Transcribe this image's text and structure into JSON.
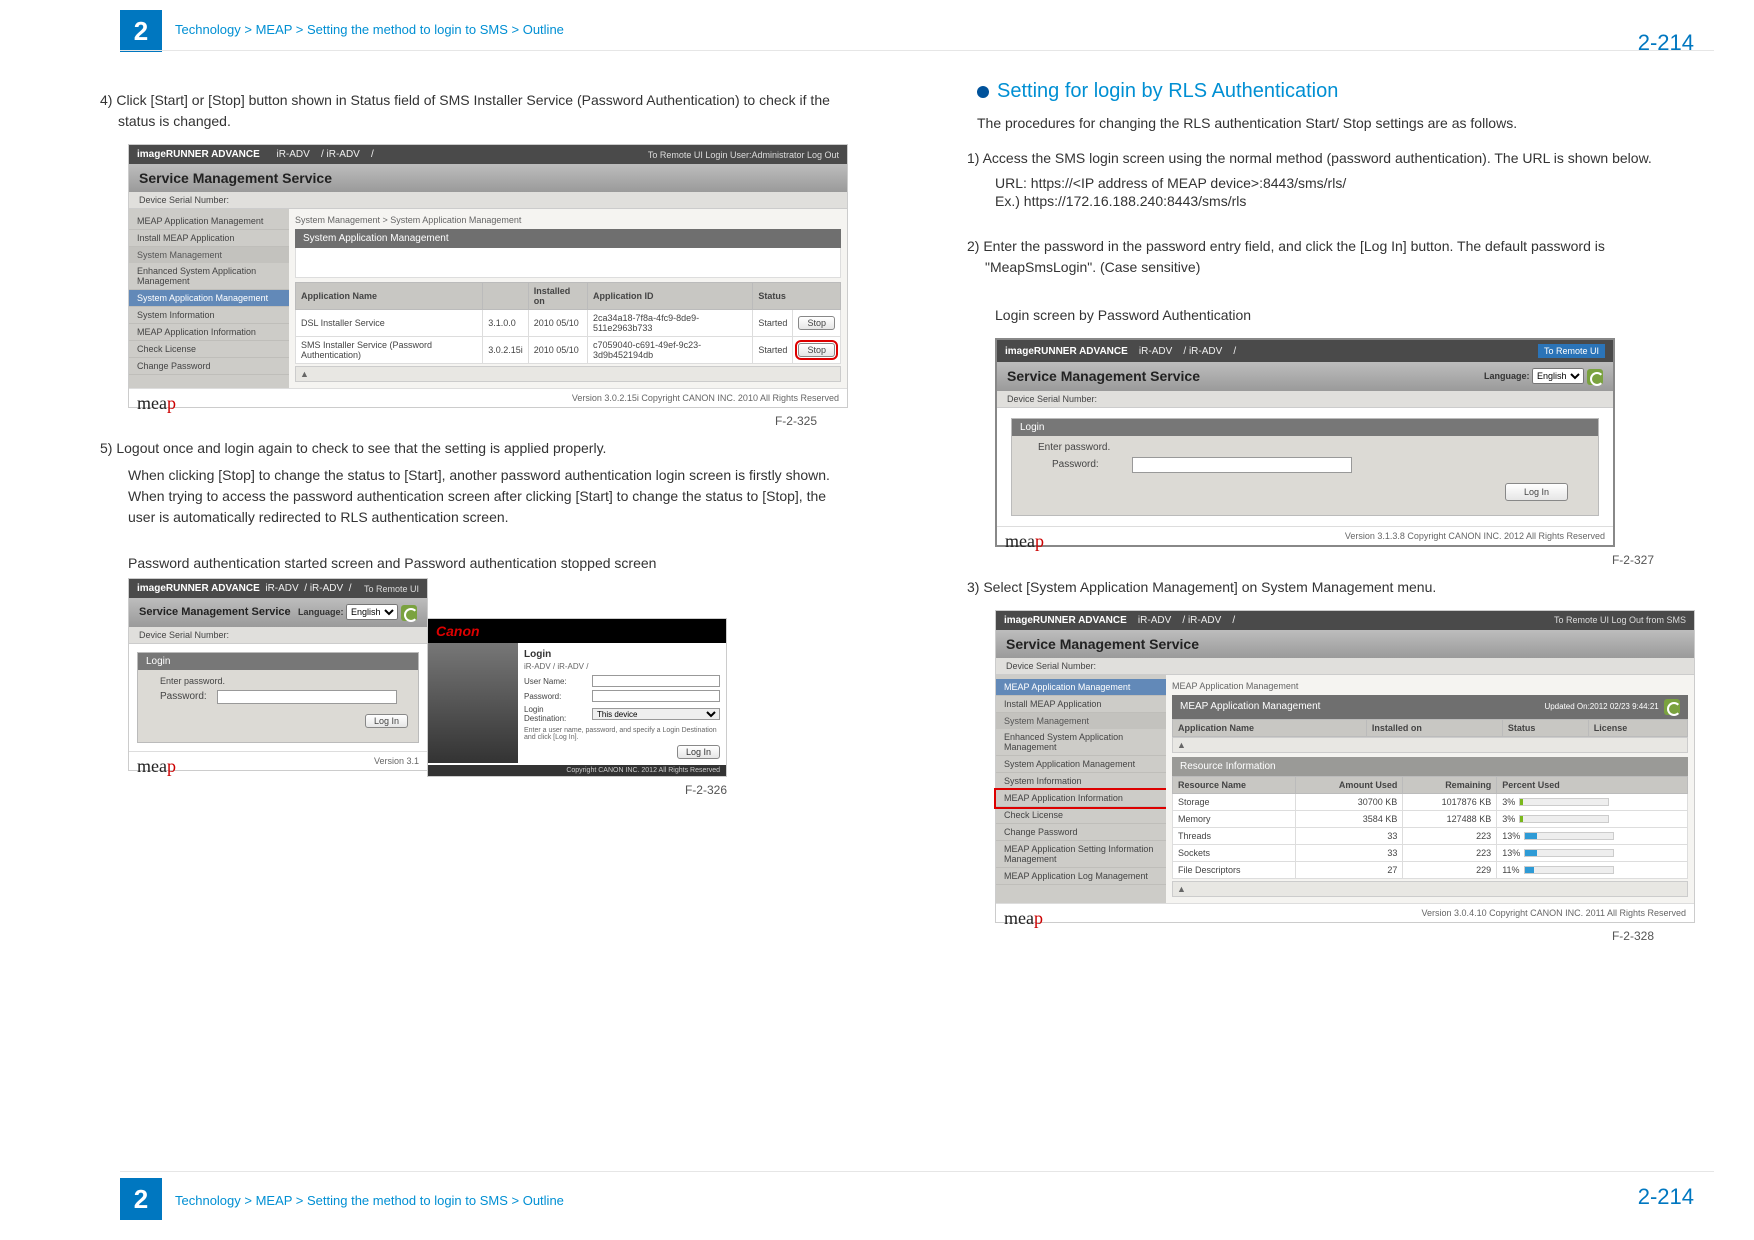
{
  "chapter_number": "2",
  "breadcrumb": "Technology > MEAP > Setting the method to login to SMS > Outline",
  "page_number": "2-214",
  "left": {
    "step4": "4) Click [Start] or [Stop] button shown in Status field of SMS Installer Service (Password Authentication) to check if the status is changed.",
    "fig1_caption": "F-2-325",
    "step5_line1": "5) Logout once and login again to check to see that the setting is applied properly.",
    "step5_line2": "When clicking [Stop] to change the status to [Start], another password authentication login screen is firstly shown. When trying to access the password authentication screen after clicking [Start] to change the status to [Stop], the user is automatically redirected to RLS authentication screen.",
    "dual_caption": "Password authentication started screen and Password authentication stopped screen",
    "fig2_caption": "F-2-326"
  },
  "right": {
    "section": "Setting for login by RLS Authentication",
    "desc": "The procedures for changing the RLS authentication Start/ Stop settings are as follows.",
    "step1": "1) Access the SMS login screen using the normal method (password authentication). The URL is shown below.",
    "url1": "URL: https://<IP address of MEAP device>:8443/sms/rls/",
    "url2": "Ex.) https://172.16.188.240:8443/sms/rls",
    "step2": "2) Enter the password in the password entry field, and click the [Log In] button. The default password is \"MeapSmsLogin\". (Case sensitive)",
    "login_caption": "Login screen by Password Authentication",
    "fig3_caption": "F-2-327",
    "step3": "3) Select [System Application Management] on System Management menu.",
    "fig4_caption": "F-2-328"
  },
  "fig1": {
    "product": "imageRUNNER ADVANCE",
    "model_l": "iR-ADV",
    "model_r": "/ iR-ADV",
    "slash": "/",
    "links": "To Remote UI   Login User:Administrator Log Out",
    "sms": "Service Management Service",
    "serial": "Device Serial Number:",
    "nav": [
      "MEAP Application Management",
      "Install MEAP Application",
      "System Management",
      "Enhanced System Application Management",
      "System Application Management",
      "System Information",
      "MEAP Application Information",
      "Check License",
      "Change Password"
    ],
    "crumbs": "System Management > System Application Management",
    "panel": "System Application Management",
    "th": [
      "Application Name",
      "",
      "Installed on",
      "Application ID",
      "Status",
      ""
    ],
    "rows": [
      {
        "name": "DSL Installer Service",
        "ver": "3.1.0.0",
        "inst": "2010 05/10",
        "id": "2ca34a18-7f8a-4fc9-8de9-511e2963b733",
        "status": "Started",
        "btn": "Stop"
      },
      {
        "name": "SMS Installer Service (Password Authentication)",
        "ver": "3.0.2.15i",
        "inst": "2010 05/10",
        "id": "c7059040-c691-49ef-9c23-3d9b452194db",
        "status": "Started",
        "btn": "Stop"
      }
    ],
    "version": "Version 3.0.2.15i Copyright CANON INC. 2010 All Rights Reserved"
  },
  "fig_dual_left": {
    "product": "imageRUNNER ADVANCE",
    "model_l": "iR-ADV",
    "model_r": "/ iR-ADV",
    "slash": "/",
    "links": "To Remote UI",
    "sms": "Service Management Service",
    "lang_label": "Language:",
    "lang": "English",
    "serial": "Device Serial Number:",
    "login": "Login",
    "enter": "Enter password.",
    "pw": "Password:",
    "btn": "Log In",
    "version": "Version 3.1"
  },
  "fig_dual_right": {
    "canon": "Canon",
    "login": "Login",
    "model": "iR-ADV     / iR-ADV    /",
    "user": "User Name:",
    "pw": "Password:",
    "dest": "Login Destination:",
    "dest_val": "This device",
    "hint": "Enter a user name, password, and specify a Login Destination and click [Log In].",
    "btn": "Log In",
    "copy": "Copyright CANON INC. 2012 All Rights Reserved"
  },
  "fig3": {
    "product": "imageRUNNER ADVANCE",
    "model_l": "iR-ADV",
    "model_r": "/ iR-ADV",
    "slash": "/",
    "links": "To Remote UI",
    "sms": "Service Management Service",
    "lang_label": "Language:",
    "lang": "English",
    "serial": "Device Serial Number:",
    "login": "Login",
    "enter": "Enter password.",
    "pw": "Password:",
    "btn": "Log In",
    "version": "Version 3.1.3.8 Copyright CANON INC. 2012 All Rights Reserved"
  },
  "fig4": {
    "product": "imageRUNNER ADVANCE",
    "model_l": "iR-ADV",
    "model_r": "/ iR-ADV",
    "slash": "/",
    "links": "To Remote UI   Log Out from SMS",
    "sms": "Service Management Service",
    "serial": "Device Serial Number:",
    "nav": [
      "MEAP Application Management",
      "Install MEAP Application",
      "System Management",
      "Enhanced System Application Management",
      "System Application Management",
      "System Information",
      "MEAP Application Information",
      "Check License",
      "Change Password",
      "MEAP Application Setting Information Management",
      "MEAP Application Log Management"
    ],
    "crumbs": "MEAP Application Management",
    "panel": "MEAP Application Management",
    "updated": "Updated On:2012 02/23 9:44:21",
    "th": [
      "Application Name",
      "Installed on",
      "Status",
      "License"
    ],
    "res_header": "Resource Information",
    "res_th": [
      "Resource Name",
      "Amount Used",
      "Remaining",
      "Percent Used"
    ],
    "res_rows": [
      {
        "name": "Storage",
        "used": "30700 KB",
        "rem": "1017876 KB",
        "pct": "3%",
        "w": 3,
        "c": "l"
      },
      {
        "name": "Memory",
        "used": "3584 KB",
        "rem": "127488 KB",
        "pct": "3%",
        "w": 3,
        "c": "l"
      },
      {
        "name": "Threads",
        "used": "33",
        "rem": "223",
        "pct": "13%",
        "w": 13,
        "c": "m"
      },
      {
        "name": "Sockets",
        "used": "33",
        "rem": "223",
        "pct": "13%",
        "w": 13,
        "c": "m"
      },
      {
        "name": "File Descriptors",
        "used": "27",
        "rem": "229",
        "pct": "11%",
        "w": 11,
        "c": "m"
      }
    ],
    "version": "Version 3.0.4.10 Copyright CANON INC. 2011 All Rights Reserved"
  }
}
